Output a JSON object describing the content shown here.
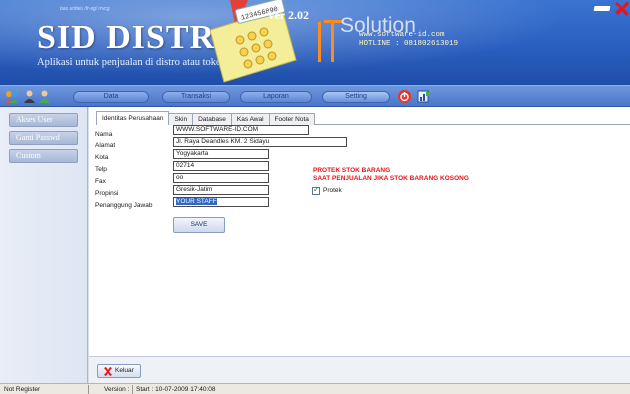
{
  "header": {
    "tagline_small": "bas unfaiu  /fr-sg/ rrvcg",
    "brand_title": "SID DISTRO",
    "brand_subtitle": "Aplikasi  untuk penjualan di distro atau toko keluarga",
    "version": "Ver 2.02",
    "calc_display": "123456890",
    "company_name": "Solution",
    "website": "www.software-id.com",
    "hotline": "HOTLINE : 081802613019",
    "icons": [
      "minimize-icon",
      "close-icon"
    ]
  },
  "toolbar": {
    "icons": [
      "group-icon",
      "user-icon",
      "user-green-icon",
      "power-icon",
      "report-icon"
    ],
    "buttons": [
      {
        "label": "Data",
        "active": false
      },
      {
        "label": "Transaksi",
        "active": false
      },
      {
        "label": "Laporan",
        "active": false
      },
      {
        "label": "Setting",
        "active": true
      }
    ]
  },
  "sidebar": {
    "items": [
      {
        "label": "Akses User"
      },
      {
        "label": "Ganti Passwd"
      },
      {
        "label": "Custom"
      }
    ]
  },
  "tabs": [
    {
      "label": "Identitas Perusahaan",
      "active": true
    },
    {
      "label": "Skin",
      "active": false
    },
    {
      "label": "Database",
      "active": false
    },
    {
      "label": "Kas Awal",
      "active": false
    },
    {
      "label": "Footer Nota",
      "active": false
    }
  ],
  "form": {
    "fields": [
      {
        "label": "Nama",
        "value": "WWW.SOFTWARE-ID.COM"
      },
      {
        "label": "Alamat",
        "value": "Jl. Raya Deandles KM. 2 Sidayu"
      },
      {
        "label": "Kota",
        "value": "Yogyakarta"
      },
      {
        "label": "Telp",
        "value": "02714"
      },
      {
        "label": "Fax",
        "value": "oo"
      },
      {
        "label": "Propinsi",
        "value": "Gresik-Jatim"
      },
      {
        "label": "Penanggung Jawab",
        "value": "YOUR STAFF"
      }
    ],
    "save_label": "SAVE"
  },
  "protek": {
    "title_line1": "PROTEK STOK BARANG",
    "title_line2": "SAAT PENJUALAN JIKA STOK BARANG KOSONG",
    "checkbox_label": "Protek",
    "checked": true
  },
  "footer": {
    "keluar_label": "Keluar"
  },
  "statusbar": {
    "registration": "Not Register",
    "version_label": "Version :",
    "start_label": "Start  : 10-07-2009 17:40:08"
  },
  "colors": {
    "header_blue": "#2a5fc0",
    "toolbar_blue": "#4a76c9",
    "alert_red": "#e8141a",
    "selection_blue": "#3168c6"
  }
}
